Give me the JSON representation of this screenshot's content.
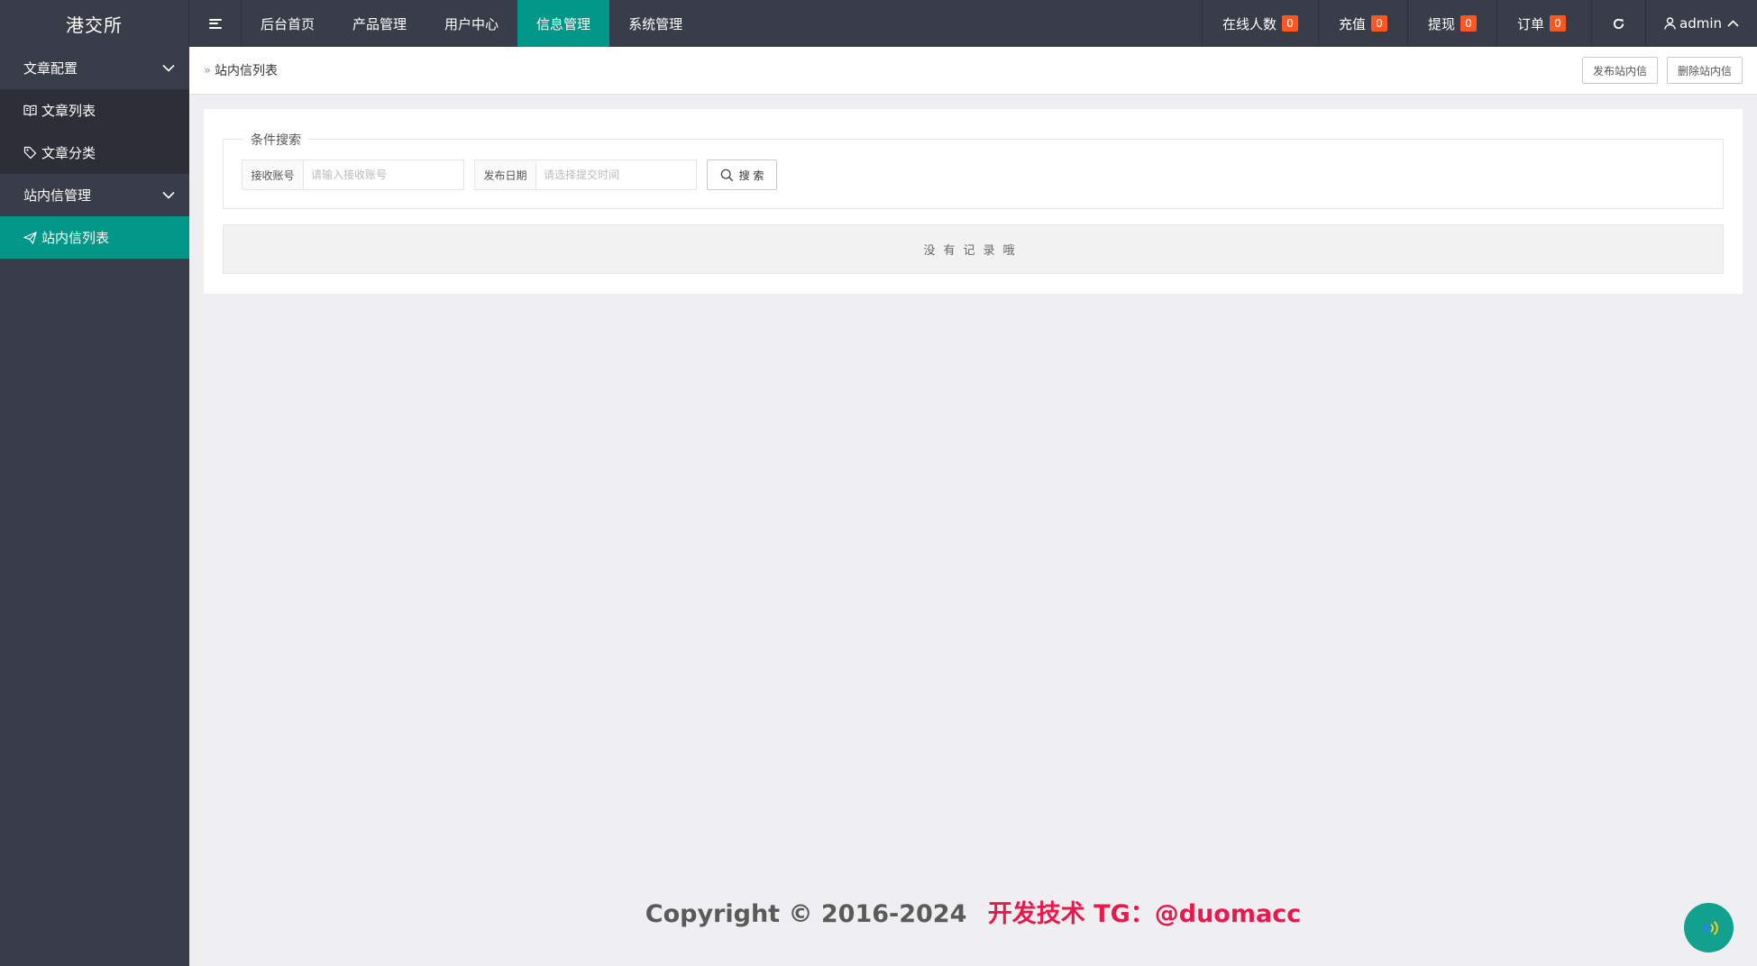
{
  "header": {
    "logo": "港交所",
    "nav": [
      {
        "label": "后台首页",
        "active": false
      },
      {
        "label": "产品管理",
        "active": false
      },
      {
        "label": "用户中心",
        "active": false
      },
      {
        "label": "信息管理",
        "active": true
      },
      {
        "label": "系统管理",
        "active": false
      }
    ],
    "stats": [
      {
        "label": "在线人数",
        "count": "0"
      },
      {
        "label": "充值",
        "count": "0"
      },
      {
        "label": "提现",
        "count": "0"
      },
      {
        "label": "订单",
        "count": "0"
      }
    ],
    "user": "admin"
  },
  "sidebar": {
    "groups": [
      {
        "label": "文章配置",
        "items": [
          {
            "label": "文章列表",
            "icon": "book-icon"
          },
          {
            "label": "文章分类",
            "icon": "tag-icon"
          }
        ]
      },
      {
        "label": "站内信管理",
        "items": [
          {
            "label": "站内信列表",
            "icon": "send-icon",
            "active": true
          }
        ]
      }
    ]
  },
  "breadcrumb": {
    "current": "站内信列表"
  },
  "actions": {
    "publish": "发布站内信",
    "delete": "删除站内信"
  },
  "search": {
    "legend": "条件搜索",
    "account_label": "接收账号",
    "account_placeholder": "请输入接收账号",
    "date_label": "发布日期",
    "date_placeholder": "请选择提交时间",
    "button": "搜 索"
  },
  "empty_text": "没有记录哦",
  "footer": {
    "copyright": "Copyright © 2016-2024",
    "contact": "开发技术 TG：@duomacc"
  },
  "colors": {
    "header_bg": "#393d49",
    "accent": "#009688",
    "badge": "#ff5722",
    "footer_red": "#e8194d"
  }
}
